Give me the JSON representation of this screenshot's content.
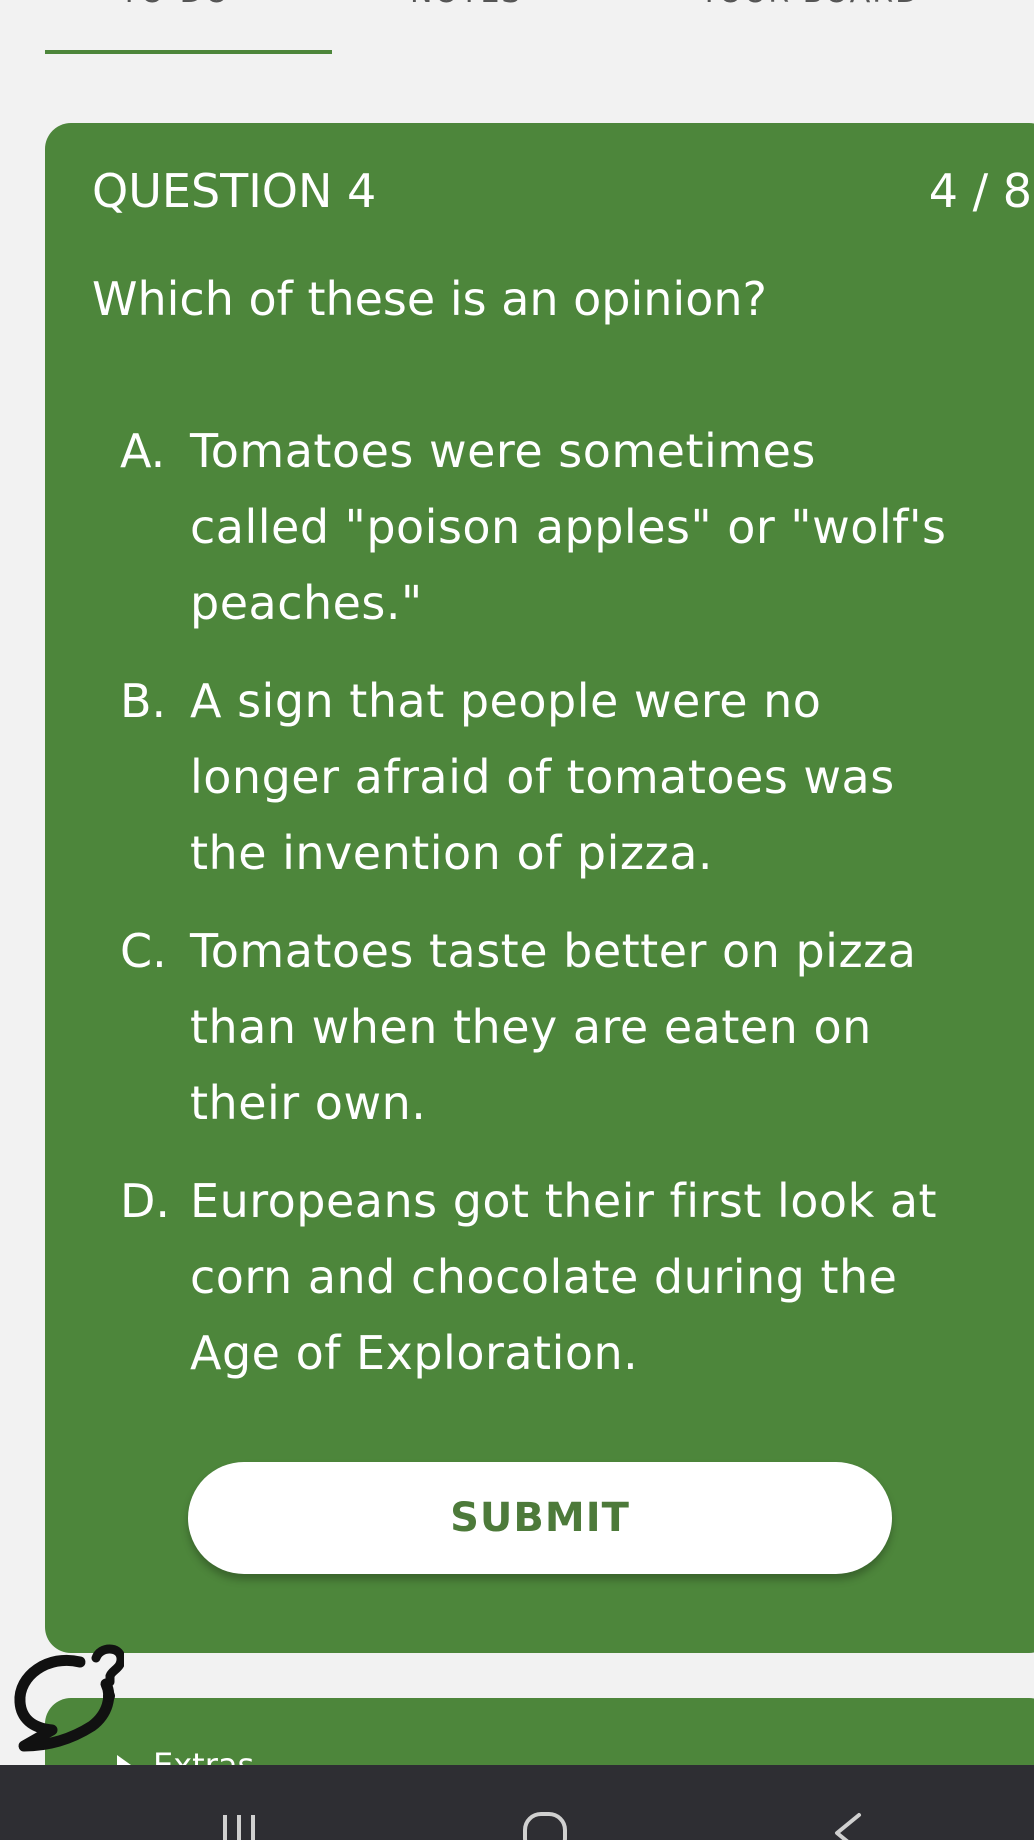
{
  "tabs": [
    {
      "label": "TO-DO"
    },
    {
      "label": "NOTES"
    },
    {
      "label": "YOUR BOARD"
    }
  ],
  "question": {
    "label": "QUESTION 4",
    "progress": "4 / 8",
    "text": "Which of these is an opinion?",
    "options": [
      {
        "letter": "A.",
        "text": "Tomatoes were sometimes called \"poison apples\" or \"wolf's peaches.\""
      },
      {
        "letter": "B.",
        "text": "A sign that people were no longer afraid of tomatoes was the invention of pizza."
      },
      {
        "letter": "C.",
        "text": "Tomatoes taste better on pizza than when they are eaten on their own."
      },
      {
        "letter": "D.",
        "text": "Europeans got their first look at corn and chocolate during the Age of Exploration."
      }
    ],
    "submit_label": "SUBMIT"
  },
  "extras": {
    "label": "Extras"
  },
  "colors": {
    "card_green": "#4d863b",
    "submit_text": "#4d7a3a",
    "background": "#f2f2f2",
    "nav_bar": "#2e2e33"
  },
  "icons": {
    "chat": "chat-help-icon",
    "recent": "recent-apps-icon",
    "home": "home-icon",
    "back": "back-icon"
  }
}
